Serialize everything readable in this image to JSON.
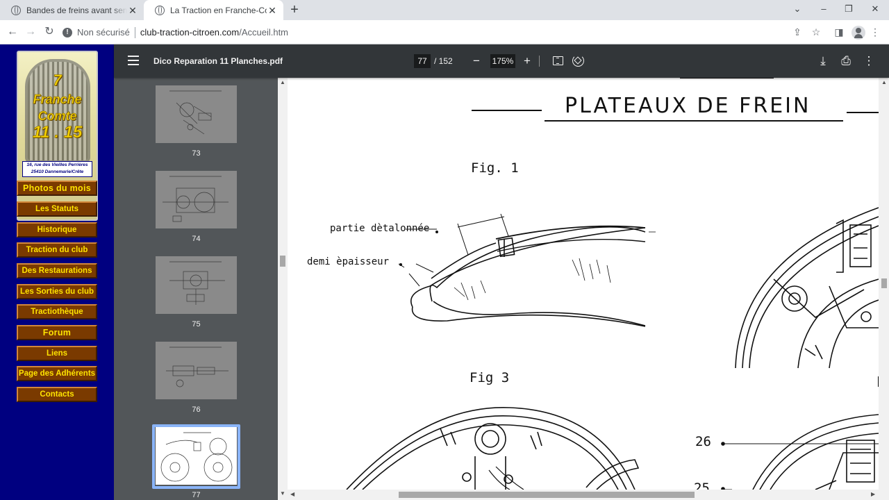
{
  "browser": {
    "tabs": [
      {
        "title": "Bandes de freins avant sens de montage",
        "active": false
      },
      {
        "title": "La Traction en Franche-Comté",
        "active": true
      }
    ],
    "new_tab": "+",
    "controls": {
      "minimize": "⌄",
      "min": "–",
      "max": "❐",
      "close": "✕"
    },
    "address": {
      "security": "Non sécurisé",
      "host": "club-traction-citroen.com",
      "path": "/Accueil.htm"
    }
  },
  "site": {
    "logo": {
      "line0": "7",
      "line1": "Franche",
      "line2": "Comte",
      "line3": "11 . 15",
      "address": "16, rue des Vieilles Perrières\n25410 Dannemarie/Crête"
    },
    "menu": [
      "Photos du mois",
      "Les Statuts",
      "Historique",
      "Traction du club",
      "Des Restaurations",
      "Les Sorties du club",
      "Tractiothèque",
      "Forum",
      "Liens",
      "Page des Adhérents",
      "Contacts"
    ]
  },
  "pdf": {
    "filename": "Dico Reparation 11 Planches.pdf",
    "current_page": "77",
    "total_pages": "/ 152",
    "zoom": "175%",
    "thumbnails": [
      "73",
      "74",
      "75",
      "76",
      "77"
    ],
    "selected_thumbnail": "77",
    "page": {
      "title": "PLATEAUX DE FREIN",
      "fig1": "Fig. 1",
      "fig3": "Fig 3",
      "label_partie": "partie dètalonnée",
      "label_demi": "demi èpaisseur",
      "label_26": "26",
      "label_25": "25"
    }
  }
}
